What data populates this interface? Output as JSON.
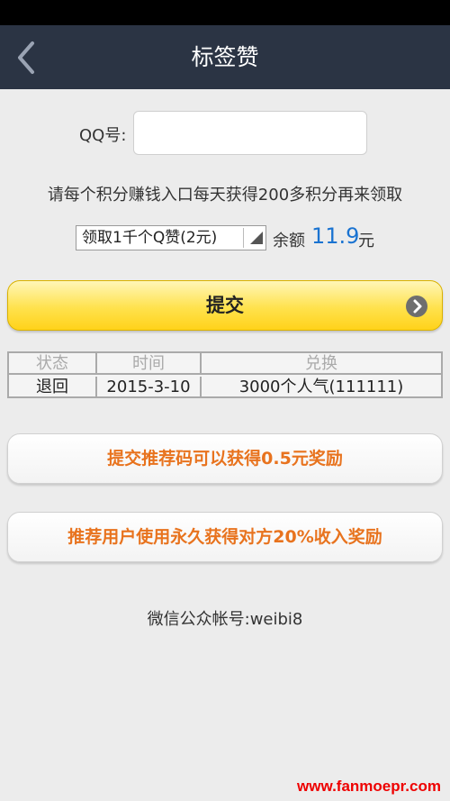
{
  "header": {
    "title": "标签赞",
    "back_icon": "chevron-left-icon"
  },
  "form": {
    "qq_label": "QQ号:",
    "qq_value": "",
    "notice": "请每个积分赚钱入口每天获得200多积分再来领取",
    "select_value": "领取1千个Q赞(2元)",
    "balance_label": "余额",
    "balance_value": "11.9",
    "balance_unit": "元",
    "submit_label": "提交"
  },
  "table": {
    "headers": [
      "状态",
      "时间",
      "兑换"
    ],
    "rows": [
      [
        "退回",
        "2015-3-10",
        "3000个人气(111111)"
      ]
    ]
  },
  "promos": {
    "referral_code": "提交推荐码可以获得0.5元奖励",
    "referral_income": "推荐用户使用永久获得对方20%收入奖励"
  },
  "footer": {
    "wechat": "微信公众帐号:weibi8",
    "watermark": "www.fanmoepr.com"
  },
  "colors": {
    "header_bg": "#2b3444",
    "accent_blue": "#1a73d1",
    "promo_orange": "#e8731e",
    "submit_yellow": "#ffe24d"
  }
}
